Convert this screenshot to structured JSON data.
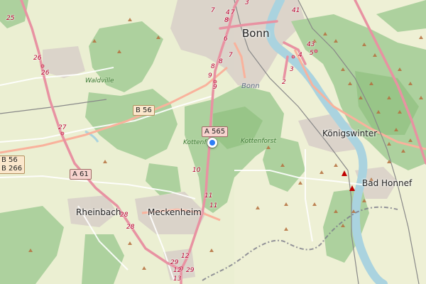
{
  "places": {
    "bonn": "Bonn",
    "koenigswinter": "Königswinter",
    "bad_honnef": "Bad Honnef",
    "meckenheim": "Meckenheim",
    "rheinbach": "Rheinbach"
  },
  "areas": {
    "waldville": "Waldville",
    "kottenforst": "Kottenforst",
    "kottenf_short": "Kottenf",
    "bonn_district": "Bonn"
  },
  "road_shields": {
    "b56_a": "B 56",
    "a565": "A 565",
    "a61": "A 61",
    "b56_b": "B 56",
    "b266": "B 266"
  },
  "junction_numbers": {
    "j25": "25",
    "j26a": "26",
    "j26b": "26",
    "j27": "27",
    "j28a": "28",
    "j28b": "28",
    "j29a": "29",
    "j29b": "29",
    "j12a": "12",
    "j12b": "12",
    "j13": "13",
    "j10": "10",
    "j11a": "11",
    "j11b": "11",
    "j9a": "9",
    "j9b": "9",
    "j8a": "8",
    "j8b": "8",
    "j8c": "8",
    "j7a": "7",
    "j7b": "7",
    "j7c": "7",
    "j6": "6",
    "j4a": "4",
    "j4b": "4",
    "j3a": "3",
    "j3b": "3",
    "j5": "5",
    "j2": "2",
    "j43": "43",
    "j41": "41"
  },
  "colors": {
    "land": "#f2efe9",
    "forest": "#add19e",
    "forest_dark": "#8fc07f",
    "water": "#aad3df",
    "motorway": "#e892a2",
    "trunk": "#f9b29c",
    "urban": "#d9d0c9",
    "boundary": "#7a7a88",
    "marker": "#2e7df6"
  },
  "marker": {
    "icon": "location-dot-icon"
  }
}
